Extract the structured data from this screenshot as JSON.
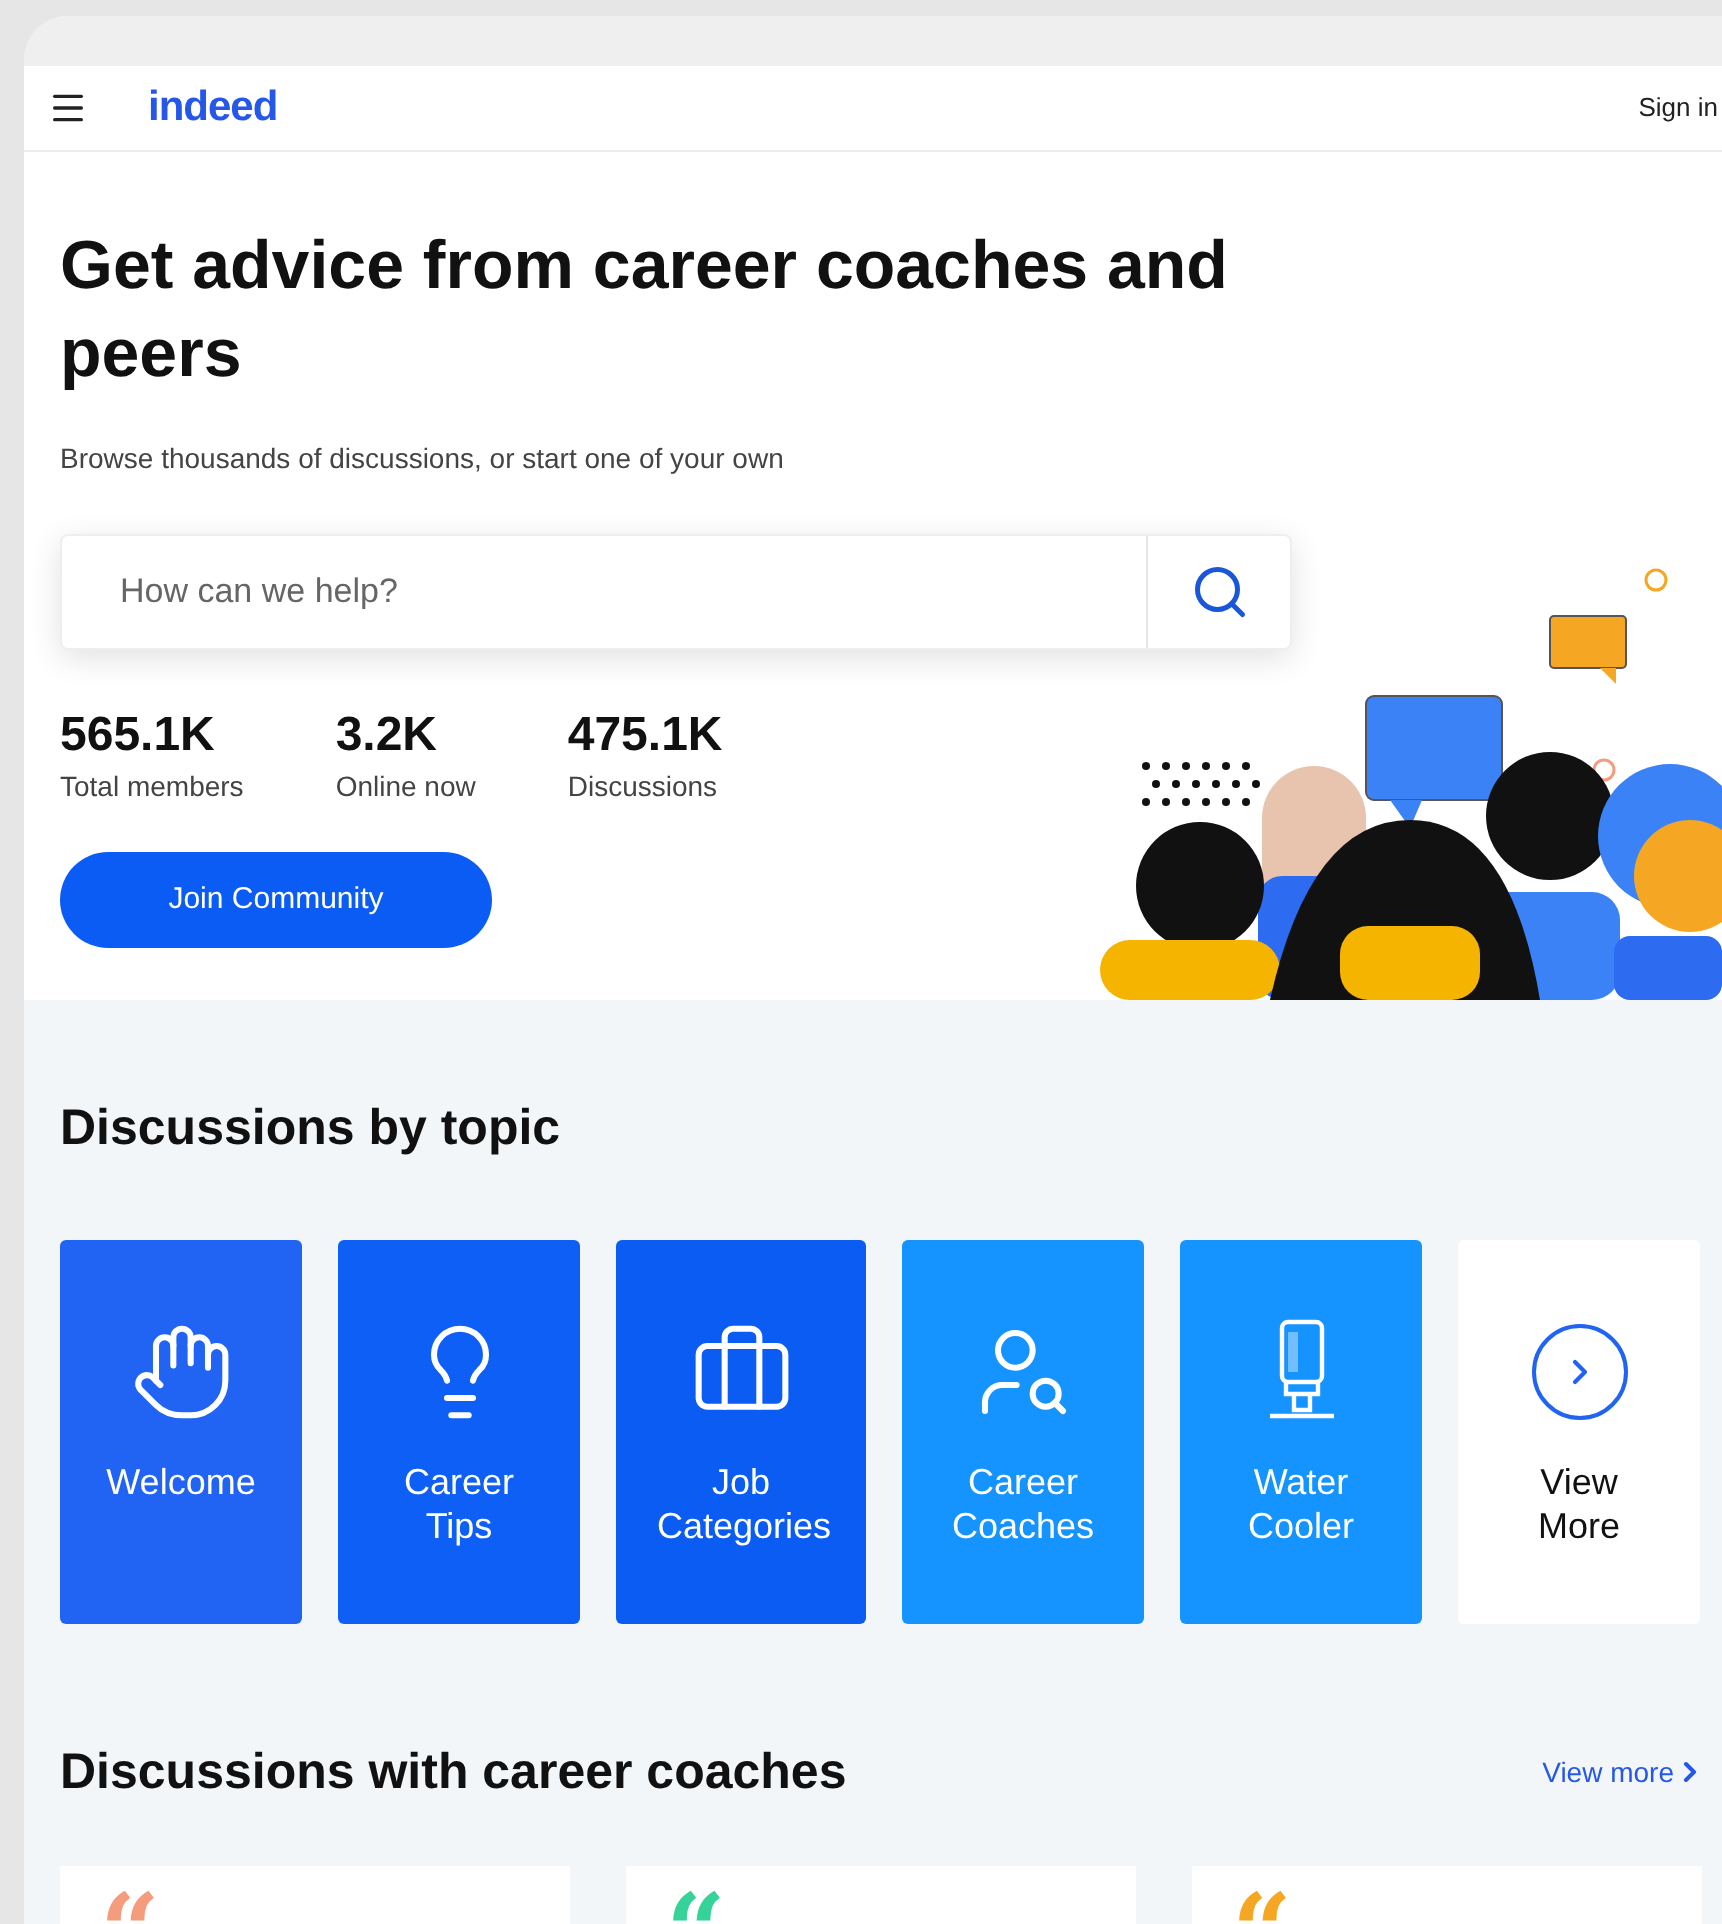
{
  "header": {
    "logo": "indeed",
    "sign_in": "Sign in"
  },
  "hero": {
    "title": "Get advice from career coaches and peers",
    "subtitle": "Browse thousands of discussions, or start one of your own",
    "search": {
      "placeholder": "How can we help?"
    },
    "stats": [
      {
        "value": "565.1K",
        "label": "Total members"
      },
      {
        "value": "3.2K",
        "label": "Online now"
      },
      {
        "value": "475.1K",
        "label": "Discussions"
      }
    ],
    "join_button": "Join Community"
  },
  "topics": {
    "title": "Discussions by topic",
    "items": [
      {
        "kind": "wave",
        "label": "Welcome",
        "color": "#2164f3"
      },
      {
        "kind": "bulb",
        "label": "Career Tips",
        "color": "#0d5ff5"
      },
      {
        "kind": "briefcase",
        "label": "Job Categories",
        "color": "#0b5cf2"
      },
      {
        "kind": "coach",
        "label": "Career Coaches",
        "color": "#1593ff"
      },
      {
        "kind": "cooler",
        "label": "Water Cooler",
        "color": "#1593ff"
      },
      {
        "kind": "more",
        "label": "View More",
        "color": "#ffffff"
      }
    ]
  },
  "coaches": {
    "title": "Discussions with career coaches",
    "view_more": "View more",
    "cards": [
      {
        "quote": "“",
        "color": "#f59c7d"
      },
      {
        "quote": "“",
        "color": "#35d39a"
      },
      {
        "quote": "“",
        "color": "#f5a623"
      }
    ]
  }
}
